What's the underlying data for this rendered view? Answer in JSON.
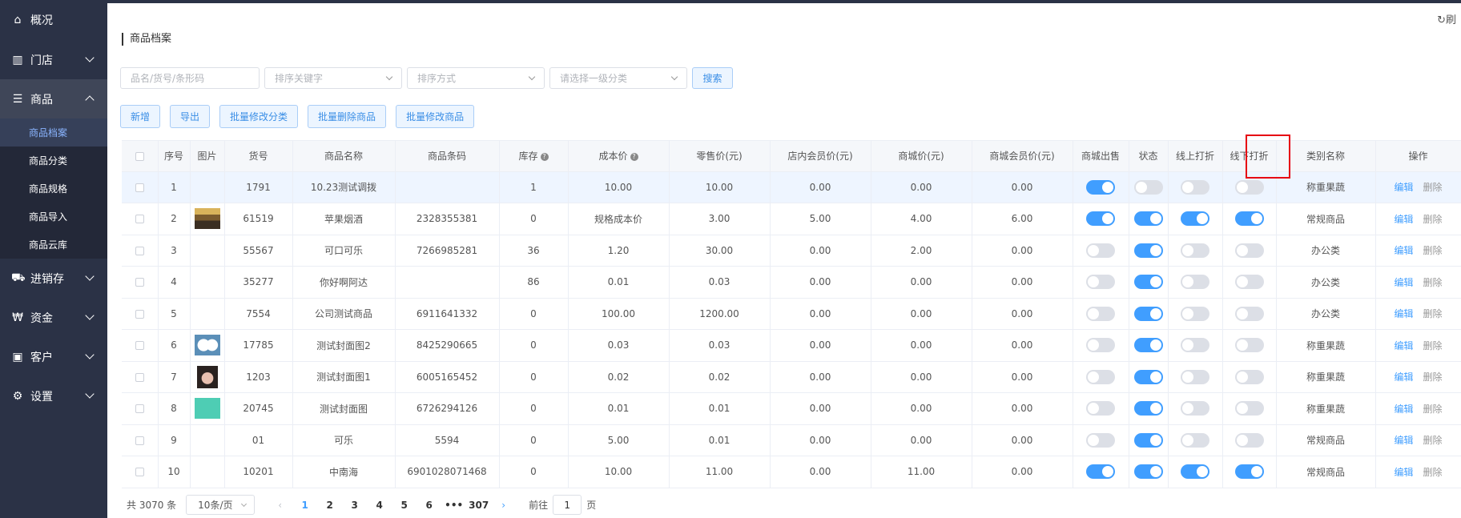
{
  "sidebar": {
    "items": [
      {
        "label": "概况",
        "icon": "home-icon"
      },
      {
        "label": "门店",
        "icon": "building-icon"
      },
      {
        "label": "商品",
        "icon": "list-icon"
      },
      {
        "label": "进销存",
        "icon": "truck-icon"
      },
      {
        "label": "资金",
        "icon": "won-icon"
      },
      {
        "label": "客户",
        "icon": "id-card-icon"
      },
      {
        "label": "设置",
        "icon": "gear-icon"
      }
    ],
    "sub_items": [
      "商品档案",
      "商品分类",
      "商品规格",
      "商品导入",
      "商品云库"
    ]
  },
  "header": {
    "refresh_label": "刷"
  },
  "page": {
    "title": "商品档案"
  },
  "filters": {
    "keyword_placeholder": "品名/货号/条形码",
    "sort_key_placeholder": "排序关键字",
    "sort_order_placeholder": "排序方式",
    "category_placeholder": "请选择一级分类",
    "search_label": "搜索"
  },
  "actions": {
    "add": "新增",
    "export": "导出",
    "batch_category": "批量修改分类",
    "batch_delete": "批量删除商品",
    "batch_edit": "批量修改商品"
  },
  "table": {
    "columns": [
      "序号",
      "图片",
      "货号",
      "商品名称",
      "商品条码",
      "库存",
      "成本价",
      "零售价(元)",
      "店内会员价(元)",
      "商城价(元)",
      "商城会员价(元)",
      "商城出售",
      "状态",
      "线上打折",
      "线下打折",
      "类别名称",
      "操作"
    ],
    "edit_label": "编辑",
    "delete_label": "删除",
    "rows": [
      {
        "no": "1",
        "img": "",
        "sku": "1791",
        "name": "10.23测试调拨",
        "barcode": "",
        "stock": "1",
        "cost": "10.00",
        "retail": "10.00",
        "member": "0.00",
        "mall": "0.00",
        "mall_member": "0.00",
        "mall_sale": true,
        "status": false,
        "online_disc": false,
        "offline_disc": false,
        "category": "称重果蔬"
      },
      {
        "no": "2",
        "img": "shop",
        "sku": "61519",
        "name": "苹果烟酒",
        "barcode": "2328355381",
        "stock": "0",
        "cost": "规格成本价",
        "retail": "3.00",
        "member": "5.00",
        "mall": "4.00",
        "mall_member": "6.00",
        "mall_sale": true,
        "status": true,
        "online_disc": true,
        "offline_disc": true,
        "category": "常规商品"
      },
      {
        "no": "3",
        "img": "",
        "sku": "55567",
        "name": "可口可乐",
        "barcode": "7266985281",
        "stock": "36",
        "cost": "1.20",
        "retail": "30.00",
        "member": "0.00",
        "mall": "2.00",
        "mall_member": "0.00",
        "mall_sale": false,
        "status": true,
        "online_disc": false,
        "offline_disc": false,
        "category": "办公类"
      },
      {
        "no": "4",
        "img": "",
        "sku": "35277",
        "name": "你好啊阿达",
        "barcode": "",
        "stock": "86",
        "cost": "0.01",
        "retail": "0.03",
        "member": "0.00",
        "mall": "0.00",
        "mall_member": "0.00",
        "mall_sale": false,
        "status": true,
        "online_disc": false,
        "offline_disc": false,
        "category": "办公类"
      },
      {
        "no": "5",
        "img": "",
        "sku": "7554",
        "name": "公司测试商品",
        "barcode": "6911641332",
        "stock": "0",
        "cost": "100.00",
        "retail": "1200.00",
        "member": "0.00",
        "mall": "0.00",
        "mall_member": "0.00",
        "mall_sale": false,
        "status": true,
        "online_disc": false,
        "offline_disc": false,
        "category": "办公类"
      },
      {
        "no": "6",
        "img": "eggs",
        "sku": "17785",
        "name": "测试封面图2",
        "barcode": "8425290665",
        "stock": "0",
        "cost": "0.03",
        "retail": "0.03",
        "member": "0.00",
        "mall": "0.00",
        "mall_member": "0.00",
        "mall_sale": false,
        "status": true,
        "online_disc": false,
        "offline_disc": false,
        "category": "称重果蔬"
      },
      {
        "no": "7",
        "img": "cat",
        "sku": "1203",
        "name": "测试封面图1",
        "barcode": "6005165452",
        "stock": "0",
        "cost": "0.02",
        "retail": "0.02",
        "member": "0.00",
        "mall": "0.00",
        "mall_member": "0.00",
        "mall_sale": false,
        "status": true,
        "online_disc": false,
        "offline_disc": false,
        "category": "称重果蔬"
      },
      {
        "no": "8",
        "img": "teal",
        "sku": "20745",
        "name": "测试封面图",
        "barcode": "6726294126",
        "stock": "0",
        "cost": "0.01",
        "retail": "0.01",
        "member": "0.00",
        "mall": "0.00",
        "mall_member": "0.00",
        "mall_sale": false,
        "status": true,
        "online_disc": false,
        "offline_disc": false,
        "category": "称重果蔬"
      },
      {
        "no": "9",
        "img": "",
        "sku": "01",
        "name": "可乐",
        "barcode": "5594",
        "stock": "0",
        "cost": "5.00",
        "retail": "0.01",
        "member": "0.00",
        "mall": "0.00",
        "mall_member": "0.00",
        "mall_sale": false,
        "status": true,
        "online_disc": false,
        "offline_disc": false,
        "category": "常规商品"
      },
      {
        "no": "10",
        "img": "",
        "sku": "10201",
        "name": "中南海",
        "barcode": "6901028071468",
        "stock": "0",
        "cost": "10.00",
        "retail": "11.00",
        "member": "0.00",
        "mall": "11.00",
        "mall_member": "0.00",
        "mall_sale": true,
        "status": true,
        "online_disc": true,
        "offline_disc": true,
        "category": "常规商品"
      }
    ]
  },
  "pagination": {
    "total": "共 3070 条",
    "page_size": "10条/页",
    "pages": [
      "1",
      "2",
      "3",
      "4",
      "5",
      "6",
      "•••",
      "307"
    ],
    "current": "1",
    "goto_prefix": "前往",
    "goto_value": "1",
    "goto_suffix": "页"
  },
  "colors": {
    "sidebar_bg": "#2b3246",
    "accent": "#409eff",
    "highlight": "#e60012"
  }
}
